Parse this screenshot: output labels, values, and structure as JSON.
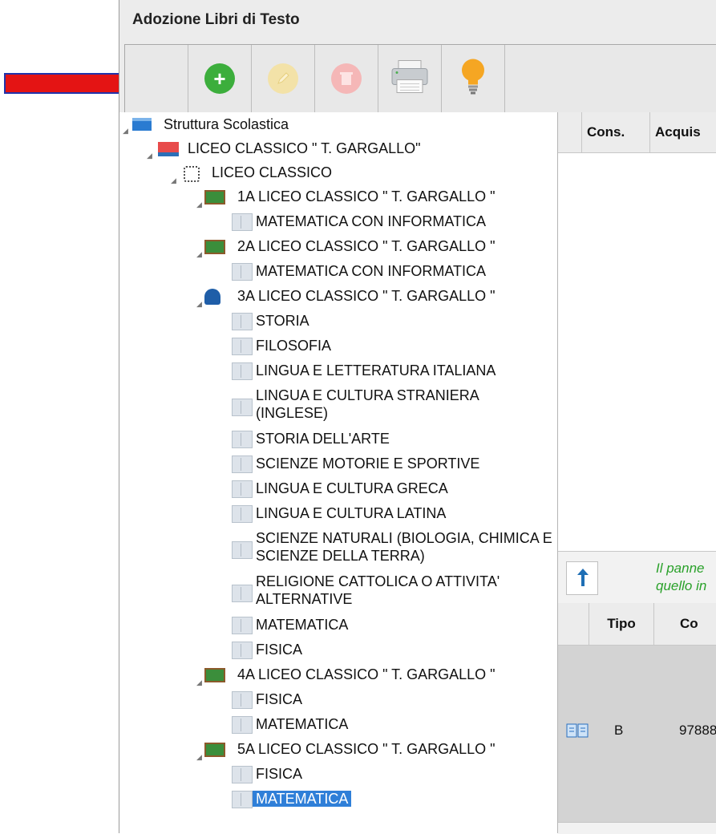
{
  "window": {
    "title": "Adozione Libri di Testo"
  },
  "toolbar": {
    "buttons": [
      {
        "name": "add",
        "icon": "plus-circle-icon",
        "color": "#3cae3c",
        "enabled": true
      },
      {
        "name": "edit",
        "icon": "pencil-icon",
        "color": "#f1d98a",
        "enabled": false
      },
      {
        "name": "delete",
        "icon": "trash-icon",
        "color": "#f2a4a4",
        "enabled": false
      },
      {
        "name": "print",
        "icon": "printer-icon",
        "enabled": true
      },
      {
        "name": "hint",
        "icon": "lightbulb-icon",
        "color": "#f5a623",
        "enabled": true
      }
    ]
  },
  "tree": {
    "root": "Struttura Scolastica",
    "school": "LICEO CLASSICO \" T. GARGALLO\"",
    "course": "LICEO CLASSICO",
    "classes": [
      {
        "label": "1A LICEO CLASSICO \" T. GARGALLO \"",
        "subjects": [
          "MATEMATICA CON INFORMATICA"
        ]
      },
      {
        "label": "2A LICEO CLASSICO \" T. GARGALLO \"",
        "subjects": [
          "MATEMATICA CON INFORMATICA"
        ]
      },
      {
        "label": "3A LICEO CLASSICO \" T. GARGALLO \"",
        "subjects": [
          "STORIA",
          "FILOSOFIA",
          "LINGUA E LETTERATURA ITALIANA",
          "LINGUA E CULTURA STRANIERA (INGLESE)",
          "STORIA DELL'ARTE",
          "SCIENZE MOTORIE E SPORTIVE",
          "LINGUA E CULTURA GRECA",
          "LINGUA E CULTURA LATINA",
          "SCIENZE NATURALI (BIOLOGIA, CHIMICA E SCIENZE DELLA TERRA)",
          "RELIGIONE CATTOLICA O ATTIVITA' ALTERNATIVE",
          "MATEMATICA",
          "FISICA"
        ]
      },
      {
        "label": "4A LICEO CLASSICO \" T. GARGALLO \"",
        "subjects": [
          "FISICA",
          "MATEMATICA"
        ]
      },
      {
        "label": "5A LICEO CLASSICO \" T. GARGALLO \"",
        "subjects": [
          "FISICA",
          "MATEMATICA"
        ]
      }
    ],
    "selected": "MATEMATICA"
  },
  "right_panel": {
    "top_headers": [
      "Cons.",
      "Acquis"
    ],
    "note_text": [
      "Il panne",
      "quello in"
    ],
    "table_headers": [
      "Tipo",
      "Co"
    ],
    "row": {
      "tipo": "B",
      "code": "97888"
    }
  },
  "annotation": {
    "arrow_color": "#e01010"
  }
}
